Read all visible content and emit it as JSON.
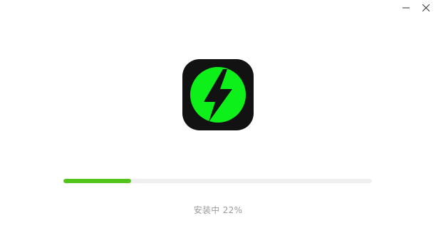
{
  "window": {
    "minimize_icon": "minimize-icon",
    "close_icon": "close-icon"
  },
  "app_icon": {
    "icon": "lightning-bolt-icon",
    "background_color": "#121212",
    "circle_color": "#0ef01a",
    "bolt_color": "#121212"
  },
  "progress": {
    "value": 0.22,
    "fill_color": "#52c41a",
    "track_color": "#efefef"
  },
  "status": {
    "label": "安装中",
    "percent_text": "22%"
  }
}
